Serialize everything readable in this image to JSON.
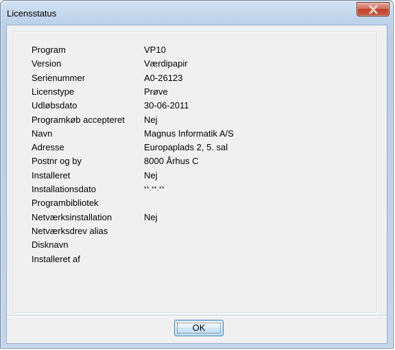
{
  "window": {
    "title": "Licensstatus"
  },
  "icons": {
    "close": "close-icon"
  },
  "fields": [
    {
      "label": "Program",
      "value": "VP10"
    },
    {
      "label": "Version",
      "value": "Værdipapir"
    },
    {
      "label": "Serienummer",
      "value": "A0-26123"
    },
    {
      "label": "Licenstype",
      "value": "Prøve"
    },
    {
      "label": "Udløbsdato",
      "value": "30-06-2011"
    },
    {
      "label": "Programkøb accepteret",
      "value": "Nej"
    },
    {
      "label": "Navn",
      "value": "Magnus Informatik A/S"
    },
    {
      "label": "Adresse",
      "value": "Europaplads 2, 5. sal"
    },
    {
      "label": "Postnr og by",
      "value": "8000 Århus C"
    },
    {
      "label": "Installeret",
      "value": "Nej"
    },
    {
      "label": "Installationsdato",
      "value": "**.**.**"
    },
    {
      "label": "Programbibliotek",
      "value": ""
    },
    {
      "label": "Netværksinstallation",
      "value": "Nej"
    },
    {
      "label": "Netværksdrev alias",
      "value": ""
    },
    {
      "label": "Disknavn",
      "value": ""
    },
    {
      "label": "Installeret af",
      "value": ""
    }
  ],
  "buttons": {
    "ok": "OK"
  }
}
